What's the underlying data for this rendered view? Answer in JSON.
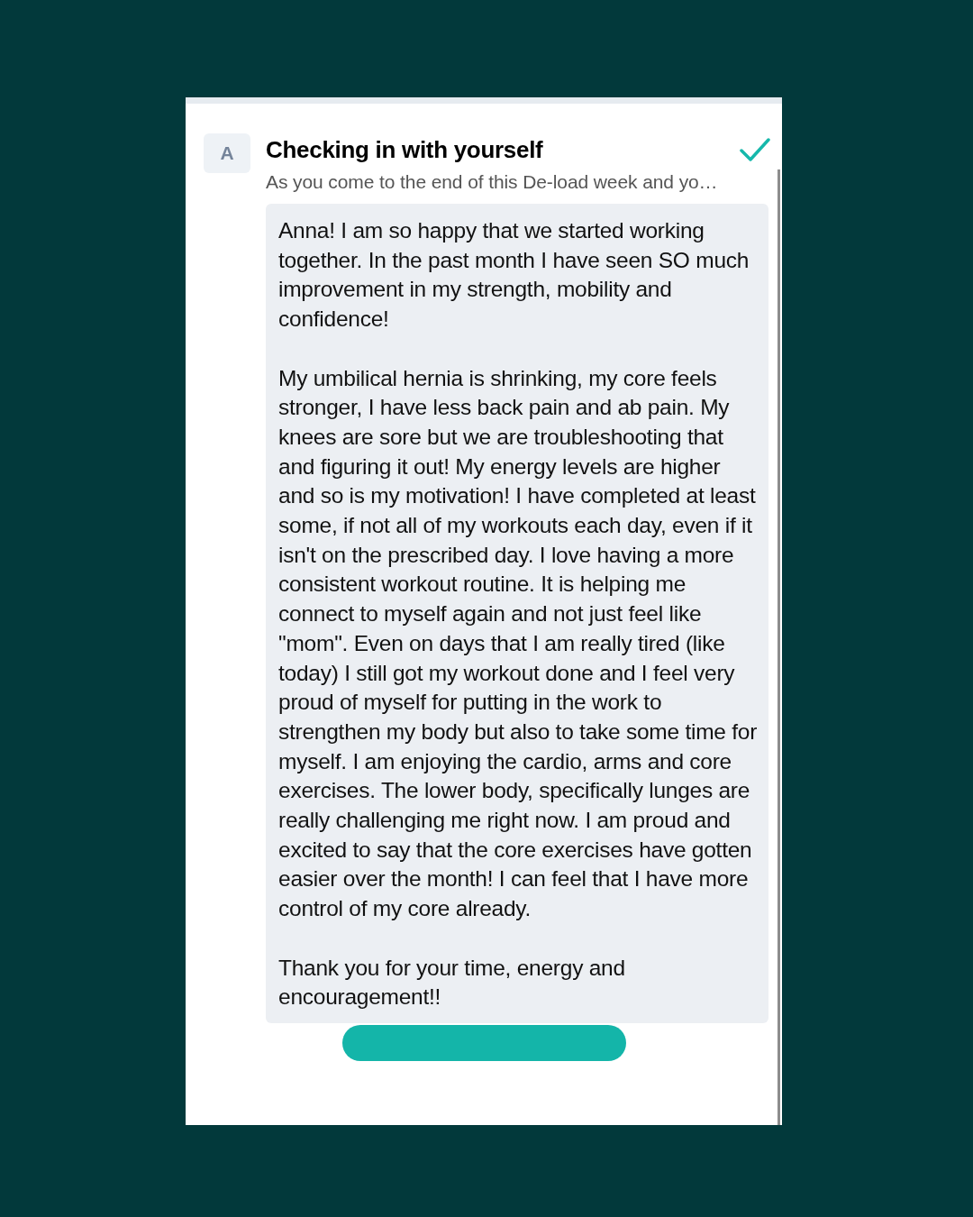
{
  "question": {
    "avatar": "A",
    "title": "Checking in with yourself",
    "completed": true,
    "subtitle": "As you come to the end of this De-load week and yo…"
  },
  "answer": {
    "paragraphs": [
      "Anna! I am so happy that we started working together. In the past month I have seen SO much improvement in my strength, mobility and confidence!",
      "My umbilical hernia is shrinking, my core feels stronger, I have less back pain and ab pain. My knees are sore but we are troubleshooting that and figuring it out! My energy levels are higher and so is my motivation! I have completed at least some, if not all of my workouts each day, even if it isn't on the prescribed day. I love having a more consistent workout routine. It is helping me connect to myself again and not just feel like \"mom\". Even on days that I am really tired (like today) I still got my workout done and I feel very proud of myself for putting in the work to strengthen my body but also to take some time for myself. I am enjoying the cardio, arms and core exercises. The lower body, specifically lunges are really challenging me right now. I am proud and excited to say that the core exercises have gotten easier over the month! I can feel that I have more control of my core already.",
      "Thank you for your time, energy and encouragement!!"
    ]
  }
}
